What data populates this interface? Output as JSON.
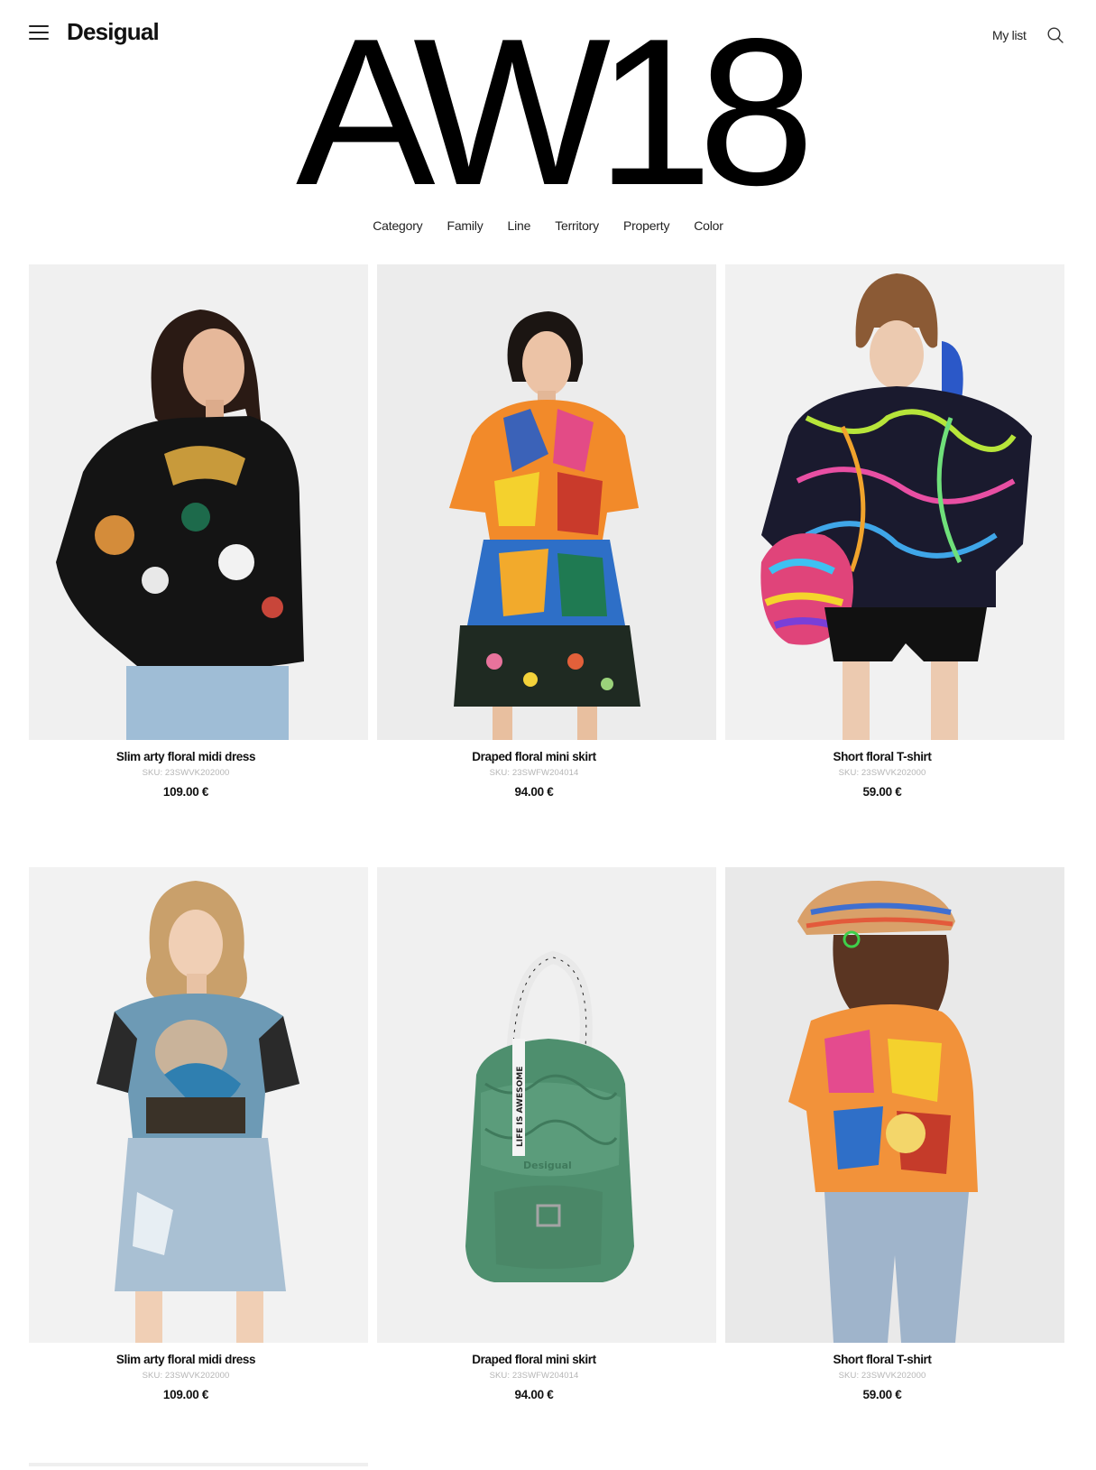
{
  "header": {
    "brand": "Desigual",
    "my_list": "My list",
    "hero_title": "AW18"
  },
  "filters": [
    "Category",
    "Family",
    "Line",
    "Territory",
    "Property",
    "Color"
  ],
  "products": [
    {
      "name": "Slim arty floral midi dress",
      "sku": "SKU: 23SWVK202000",
      "price": "109.00 €"
    },
    {
      "name": "Draped floral mini skirt",
      "sku": "SKU: 23SWFW204014",
      "price": "94.00 €"
    },
    {
      "name": "Short floral T-shirt",
      "sku": "SKU: 23SWVK202000",
      "price": "59.00 €"
    },
    {
      "name": "Slim arty floral midi dress",
      "sku": "SKU: 23SWVK202000",
      "price": "109.00 €"
    },
    {
      "name": "Draped floral mini skirt",
      "sku": "SKU: 23SWFW204014",
      "price": "94.00 €"
    },
    {
      "name": "Short floral T-shirt",
      "sku": "SKU: 23SWVK202000",
      "price": "59.00 €"
    }
  ],
  "printed_text": {
    "backpack_strap": "LIFE IS AWESOME",
    "backpack_logo": "Desigual"
  }
}
